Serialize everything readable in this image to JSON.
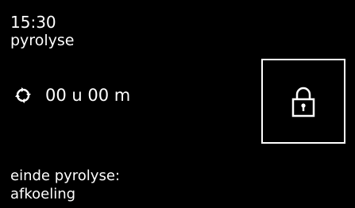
{
  "header": {
    "time": "15:30",
    "program": "pyrolyse"
  },
  "timer": {
    "icon": "cycle-arrows-icon",
    "value": "00 u 00 m"
  },
  "lock": {
    "icon": "padlock-icon"
  },
  "status": {
    "label": "einde pyrolyse:",
    "value": "afkoeling"
  },
  "colors": {
    "background": "#000000",
    "foreground": "#ffffff"
  }
}
